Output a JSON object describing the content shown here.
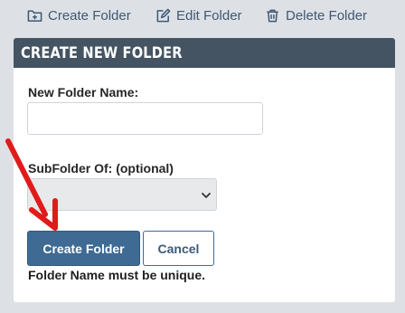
{
  "toolbar": {
    "create_label": "Create Folder",
    "edit_label": "Edit Folder",
    "delete_label": "Delete Folder"
  },
  "panel": {
    "title": "CREATE NEW FOLDER"
  },
  "form": {
    "name_label": "New Folder Name:",
    "name_value": "",
    "name_placeholder": "",
    "subfolder_label": "SubFolder Of: (optional)",
    "subfolder_selected": "",
    "create_button": "Create Folder",
    "cancel_button": "Cancel",
    "help_text": "Folder Name must be unique."
  },
  "colors": {
    "accent": "#3e6a93",
    "header": "#455462",
    "annotation_arrow": "#e01b1b"
  }
}
